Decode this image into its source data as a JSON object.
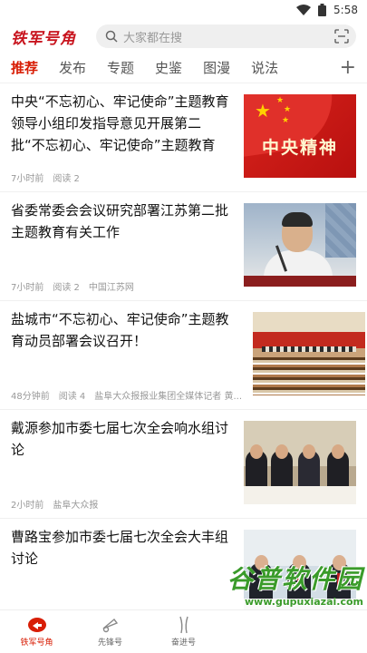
{
  "status_bar": {
    "time": "5:58"
  },
  "header": {
    "logo_text": "铁军号角",
    "search_placeholder": "大家都在搜"
  },
  "tabs": [
    {
      "label": "推荐",
      "active": true
    },
    {
      "label": "发布"
    },
    {
      "label": "专题"
    },
    {
      "label": "史鉴"
    },
    {
      "label": "图漫"
    },
    {
      "label": "说法"
    }
  ],
  "articles": [
    {
      "title": "中央“不忘初心、牢记使命”主题教育领导小组印发指导意见开展第二批“不忘初心、牢记使命”主题教育",
      "time": "7小时前",
      "reads": "阅读 2",
      "source": "",
      "thumb_caption": "中央精神"
    },
    {
      "title": "省委常委会会议研究部署江苏第二批主题教育有关工作",
      "time": "7小时前",
      "reads": "阅读 2",
      "source": "中国江苏网"
    },
    {
      "title": "盐城市“不忘初心、牢记使命”主题教育动员部署会议召开！",
      "time": "48分钟前",
      "reads": "阅读 4",
      "source": "盐阜大众报报业集团全媒体记者 黄..."
    },
    {
      "title": "戴源参加市委七届七次全会响水组讨论",
      "time": "2小时前",
      "reads": "",
      "source": "盐阜大众报"
    },
    {
      "title": "曹路宝参加市委七届七次全会大丰组讨论",
      "time": "",
      "reads": "",
      "source": ""
    }
  ],
  "watermark": {
    "big": "谷普软件园",
    "small": "www.gupuxiazai.com"
  },
  "bottom_nav": [
    {
      "label": "铁军号角",
      "icon": "horn-icon",
      "active": true
    },
    {
      "label": "先锋号",
      "icon": "trumpet-icon"
    },
    {
      "label": "奋进号",
      "icon": "road-icon"
    },
    {
      "label": "",
      "icon": "blank"
    },
    {
      "label": "",
      "icon": "blank"
    }
  ],
  "colors": {
    "accent": "#d81e06",
    "watermark": "#3a9b2a"
  }
}
